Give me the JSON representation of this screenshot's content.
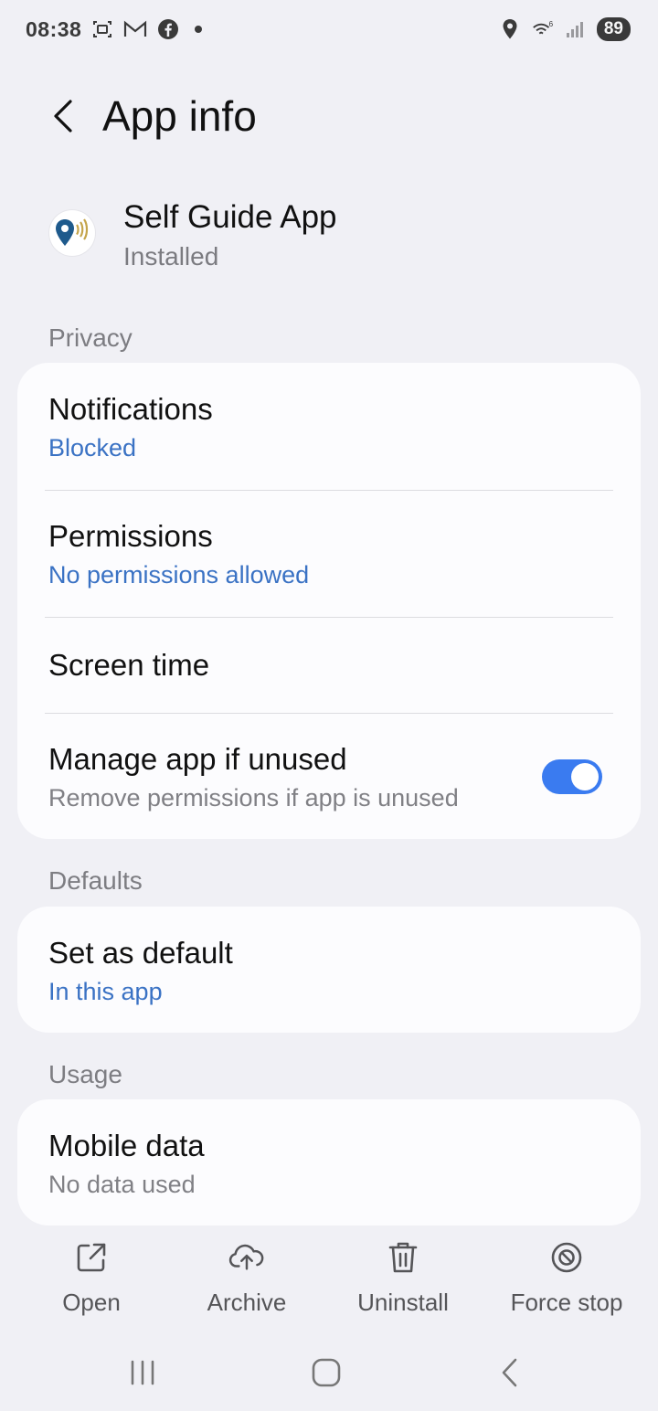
{
  "status_bar": {
    "time": "08:38",
    "battery": "89",
    "left_icons": [
      "screenshot-icon",
      "gmail-icon",
      "facebook-icon",
      "notification-dot"
    ],
    "right_icons": [
      "location-icon",
      "wifi-icon",
      "signal-icon",
      "battery-icon"
    ]
  },
  "header": {
    "title": "App info"
  },
  "app": {
    "name": "Self Guide App",
    "status": "Installed"
  },
  "sections": {
    "privacy": "Privacy",
    "defaults": "Defaults",
    "usage": "Usage"
  },
  "privacy_items": {
    "notifications": {
      "title": "Notifications",
      "sub": "Blocked"
    },
    "permissions": {
      "title": "Permissions",
      "sub": "No permissions allowed"
    },
    "screen_time": {
      "title": "Screen time"
    },
    "manage_unused": {
      "title": "Manage app if unused",
      "sub": "Remove permissions if app is unused",
      "enabled": true
    }
  },
  "defaults_items": {
    "set_default": {
      "title": "Set as default",
      "sub": "In this app"
    }
  },
  "usage_items": {
    "mobile_data": {
      "title": "Mobile data",
      "sub": "No data used"
    }
  },
  "actions": {
    "open": "Open",
    "archive": "Archive",
    "uninstall": "Uninstall",
    "force_stop": "Force stop"
  },
  "colors": {
    "background": "#f0f0f5",
    "card": "#fcfcfe",
    "accent_blue": "#3a72c4",
    "toggle_on": "#3a7bf0"
  }
}
